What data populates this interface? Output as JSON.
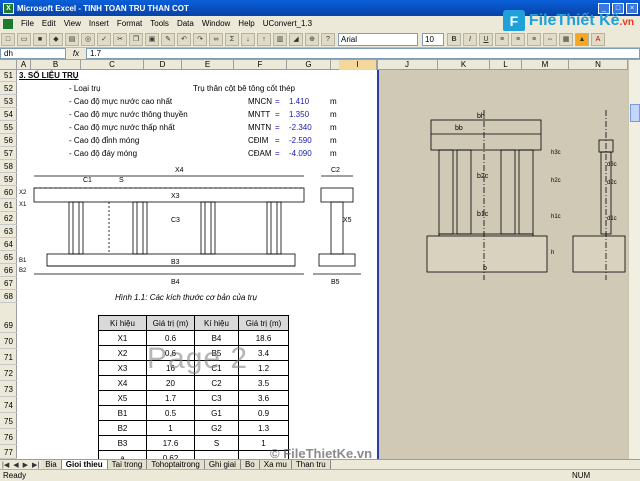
{
  "window": {
    "title": "Microsoft Excel - TINH TOAN TRU THAN COT"
  },
  "menu": [
    "File",
    "Edit",
    "View",
    "Insert",
    "Format",
    "Tools",
    "Data",
    "Window",
    "Help",
    "UConvert_1.3"
  ],
  "brand": {
    "icon": "F",
    "name": "FileThiết Kế",
    "suffix": ".vn"
  },
  "toolbar": {
    "font_name": "Arial",
    "font_size": "10"
  },
  "formula": {
    "name_box": "dh",
    "value": "1.7"
  },
  "columns": [
    "A",
    "B",
    "C",
    "D",
    "E",
    "F",
    "G",
    "H",
    "I",
    "J",
    "K",
    "L",
    "M",
    "N"
  ],
  "rows": [
    "51",
    "52",
    "53",
    "54",
    "55",
    "56",
    "57",
    "58",
    "59",
    "60",
    "61",
    "62",
    "63",
    "64",
    "65",
    "66",
    "67",
    "68",
    "69",
    "70",
    "71",
    "72",
    "73",
    "74",
    "75",
    "76",
    "77",
    "78",
    "79"
  ],
  "section": {
    "heading": "3. SỐ LIỆU TRỤ",
    "pier_type_label": "- Loại trụ",
    "pier_type_value": "Trụ thân cột bê tông cốt thép",
    "params": [
      {
        "label": "- Cao độ mực nước cao nhất",
        "symbol": "MNCN",
        "value": "1.410",
        "unit": "m"
      },
      {
        "label": "- Cao độ mực nước thông thuyền",
        "symbol": "MNTT",
        "value": "1.350",
        "unit": "m"
      },
      {
        "label": "- Cao độ mực nước thấp nhất",
        "symbol": "MNTN",
        "value": "-2.340",
        "unit": "m"
      },
      {
        "label": "- Cao độ đỉnh móng",
        "symbol": "CĐIM",
        "value": "-2.590",
        "unit": "m"
      },
      {
        "label": "- Cao độ đáy móng",
        "symbol": "CĐAM",
        "value": "-4.090",
        "unit": "m"
      }
    ]
  },
  "drawing": {
    "caption": "Hình 1.1: Các kích thước cơ bản của trụ",
    "labels": [
      "X4",
      "C1",
      "S",
      "X3",
      "C3",
      "X2",
      "X1",
      "C2",
      "X5",
      "B1",
      "B2",
      "B3",
      "B4",
      "B5"
    ],
    "right_labels": [
      "bh",
      "bb",
      "b2c",
      "b1c",
      "b",
      "h3c",
      "h2c",
      "h1c",
      "h",
      "d3c",
      "d2c",
      "d1c"
    ]
  },
  "table": {
    "headers": [
      "Kí hiệu",
      "Giá trị (m)",
      "Kí hiệu",
      "Giá trị (m)"
    ],
    "rows": [
      [
        "X1",
        "0.6",
        "B4",
        "18.6"
      ],
      [
        "X2",
        "0.6",
        "B5",
        "3.4"
      ],
      [
        "X3",
        "16",
        "C1",
        "1.2"
      ],
      [
        "X4",
        "20",
        "C2",
        "3.5"
      ],
      [
        "X5",
        "1.7",
        "C3",
        "3.6"
      ],
      [
        "B1",
        "0.5",
        "G1",
        "0.9"
      ],
      [
        "B2",
        "1",
        "G2",
        "1.3"
      ],
      [
        "B3",
        "17.6",
        "S",
        "1"
      ],
      [
        "a",
        "0.62",
        "",
        ""
      ]
    ]
  },
  "overlay": {
    "page_watermark": "Page 2",
    "footer_watermark": "© FileThietKe.vn"
  },
  "sheet_tabs": [
    "Bia",
    "Gioi thieu",
    "Tai trong",
    "Tohoptaitrong",
    "Ghi giai",
    "Bo",
    "Xa mu",
    "Than tru"
  ],
  "status": {
    "left": "Ready",
    "num": "NUM"
  }
}
